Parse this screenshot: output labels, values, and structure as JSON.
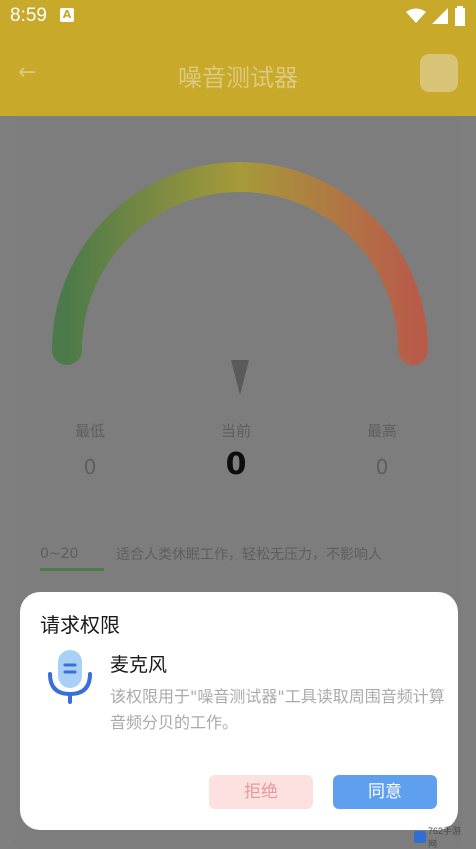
{
  "status_bar": {
    "time": "8:59",
    "notification_icon": "A"
  },
  "app_bar": {
    "title": "噪音测试器"
  },
  "gauge": {
    "colors": [
      "#4d7a4a",
      "#a69a3a",
      "#b85c4a"
    ]
  },
  "stats": {
    "min_label": "最低",
    "min_value": "0",
    "current_label": "当前",
    "current_value": "0",
    "max_label": "最高",
    "max_value": "0"
  },
  "level": {
    "range": "0~20",
    "description": "适合人类休眠工作，轻松无压力，不影响人"
  },
  "dialog": {
    "title": "请求权限",
    "permission_name": "麦克风",
    "permission_desc": "该权限用于\"噪音测试器\"工具读取周围音频计算音频分贝的工作。",
    "deny_label": "拒绝",
    "agree_label": "同意"
  },
  "watermark": {
    "text": "762手游网"
  }
}
